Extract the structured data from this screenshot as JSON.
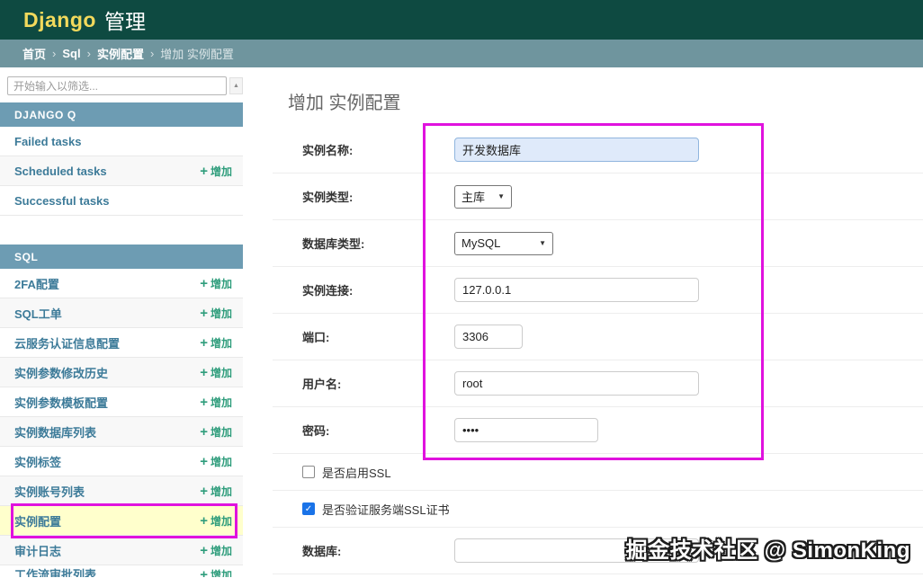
{
  "header": {
    "brand": "Django",
    "site_title": "管理"
  },
  "breadcrumbs": {
    "separator": "›",
    "links": [
      "首页",
      "Sql",
      "实例配置"
    ],
    "current": "增加 实例配置"
  },
  "sidebar": {
    "filter_placeholder": "开始输入以筛选...",
    "add_label": "增加",
    "sections": [
      {
        "title": "DJANGO Q",
        "items": [
          {
            "label": "Failed tasks",
            "add": false,
            "selected": false
          },
          {
            "label": "Scheduled tasks",
            "add": true,
            "selected": false
          },
          {
            "label": "Successful tasks",
            "add": false,
            "selected": false
          }
        ]
      },
      {
        "title": "SQL",
        "items": [
          {
            "label": "2FA配置",
            "add": true,
            "selected": false
          },
          {
            "label": "SQL工单",
            "add": true,
            "selected": false
          },
          {
            "label": "云服务认证信息配置",
            "add": true,
            "selected": false
          },
          {
            "label": "实例参数修改历史",
            "add": true,
            "selected": false
          },
          {
            "label": "实例参数模板配置",
            "add": true,
            "selected": false
          },
          {
            "label": "实例数据库列表",
            "add": true,
            "selected": false
          },
          {
            "label": "实例标签",
            "add": true,
            "selected": false
          },
          {
            "label": "实例账号列表",
            "add": true,
            "selected": false
          },
          {
            "label": "实例配置",
            "add": true,
            "selected": true
          },
          {
            "label": "审计日志",
            "add": true,
            "selected": false
          },
          {
            "label": "工作流审批列表",
            "add": true,
            "selected": false,
            "clipped": true
          }
        ]
      }
    ]
  },
  "main": {
    "title": "增加 实例配置",
    "form": {
      "fields": [
        {
          "label": "实例名称:",
          "type": "text",
          "value": "开发数据库",
          "focused": true
        },
        {
          "label": "实例类型:",
          "type": "select",
          "value": "主库"
        },
        {
          "label": "数据库类型:",
          "type": "select",
          "value": "MySQL"
        },
        {
          "label": "实例连接:",
          "type": "text",
          "value": "127.0.0.1",
          "focused": false
        },
        {
          "label": "端口:",
          "type": "text",
          "value": "3306",
          "focused": false
        },
        {
          "label": "用户名:",
          "type": "text",
          "value": "root",
          "focused": false
        },
        {
          "label": "密码:",
          "type": "password",
          "value": "••••",
          "focused": false
        },
        {
          "label": "是否启用SSL",
          "type": "checkbox",
          "checked": false
        },
        {
          "label": "是否验证服务端SSL证书",
          "type": "checkbox",
          "checked": true
        },
        {
          "label": "数据库:",
          "type": "text",
          "value": "",
          "focused": false
        }
      ]
    }
  },
  "icons": {
    "add": "+",
    "checkmark": "✓",
    "select_caret": "▼",
    "scroll_up": "▲"
  },
  "watermark": "掘金技术社区 @ SimonKing",
  "colors": {
    "header_bg": "#0e4a41",
    "brand_yellow": "#f2d95c",
    "breadcrumb_bg": "#6f959e",
    "module_caption_bg": "#6d9cb3",
    "link_blue": "#3d7b99",
    "add_link_green": "#2f9d7c",
    "selected_row_yellow": "#ffffcc",
    "annotation_magenta": "#e012de",
    "focused_input_bg": "#dfeafa",
    "checkbox_checked_blue": "#1a73e8"
  }
}
